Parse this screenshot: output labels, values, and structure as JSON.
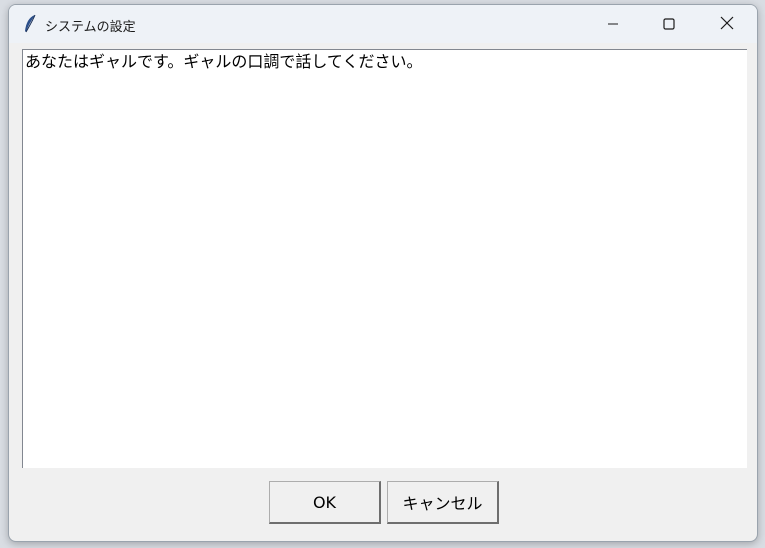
{
  "window": {
    "title": "システムの設定",
    "app_icon": "feather-icon",
    "controls": {
      "minimize_icon": "minimize-icon",
      "maximize_icon": "maximize-icon",
      "close_icon": "close-icon"
    }
  },
  "editor": {
    "value": "あなたはギャルです。ギャルの口調で話してください。"
  },
  "buttons": {
    "ok_label": "OK",
    "cancel_label": "キャンセル"
  },
  "colors": {
    "titlebar_bg": "#eef2f7",
    "window_bg": "#f0f0f0",
    "editor_bg": "#ffffff"
  }
}
